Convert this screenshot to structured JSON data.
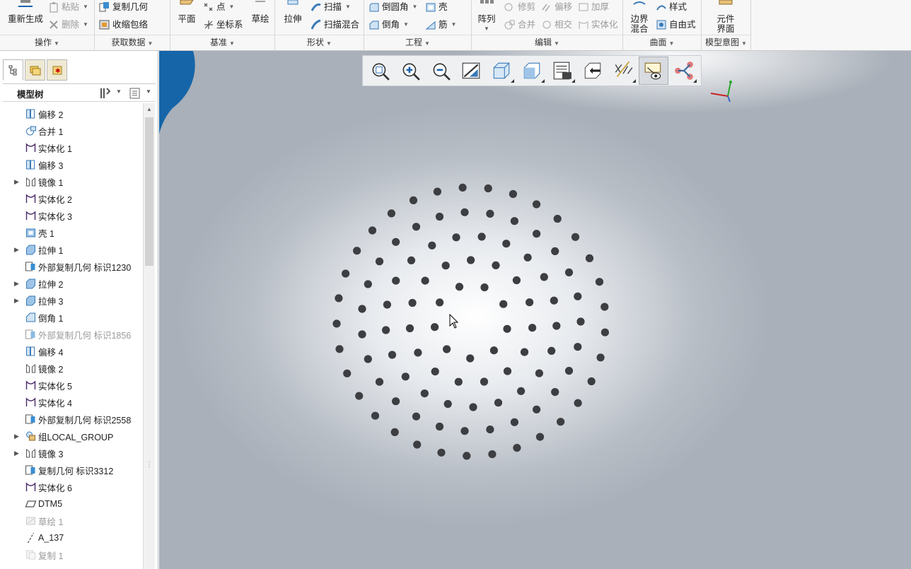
{
  "ribbon": {
    "groups": [
      {
        "label": "操作",
        "items": [
          {
            "label": "重新生成",
            "icon": "regenerate-icon",
            "disabled": false
          },
          {
            "label": "粘贴",
            "icon": "paste-icon",
            "disabled": true
          },
          {
            "label": "删除",
            "icon": "delete-icon",
            "disabled": true
          }
        ]
      },
      {
        "label": "获取数据",
        "items": [
          {
            "label": "复制几何",
            "icon": "copy-geometry-icon",
            "disabled": false
          },
          {
            "label": "收缩包络",
            "icon": "shrinkwrap-icon",
            "disabled": false
          }
        ]
      },
      {
        "label": "基准",
        "items": [
          {
            "label": "平面",
            "icon": "plane-icon",
            "disabled": false
          },
          {
            "label": "点",
            "icon": "point-icon",
            "disabled": false
          },
          {
            "label": "坐标系",
            "icon": "coordinate-system-icon",
            "disabled": false
          },
          {
            "label": "草绘",
            "icon": "sketch-icon",
            "disabled": false
          }
        ]
      },
      {
        "label": "形状",
        "items": [
          {
            "label": "拉伸",
            "icon": "extrude-icon",
            "disabled": false
          },
          {
            "label": "扫描",
            "icon": "sweep-icon",
            "disabled": false
          },
          {
            "label": "扫描混合",
            "icon": "swept-blend-icon",
            "disabled": false
          }
        ]
      },
      {
        "label": "工程",
        "items": [
          {
            "label": "倒圆角",
            "icon": "round-icon",
            "disabled": false
          },
          {
            "label": "倒角",
            "icon": "chamfer-icon",
            "disabled": false
          },
          {
            "label": "壳",
            "icon": "shell-icon",
            "disabled": false
          },
          {
            "label": "筋",
            "icon": "rib-icon",
            "disabled": false
          }
        ]
      },
      {
        "label": "编辑",
        "items": [
          {
            "label": "阵列",
            "icon": "pattern-icon",
            "disabled": false
          },
          {
            "label": "修剪",
            "icon": "trim-icon",
            "disabled": true
          },
          {
            "label": "合并",
            "icon": "merge-icon",
            "disabled": true
          },
          {
            "label": "偏移",
            "icon": "offset-icon",
            "disabled": true
          },
          {
            "label": "相交",
            "icon": "intersect-icon",
            "disabled": true
          },
          {
            "label": "加厚",
            "icon": "thicken-icon",
            "disabled": true
          },
          {
            "label": "实体化",
            "icon": "solidify-icon",
            "disabled": true
          }
        ]
      },
      {
        "label": "曲面",
        "items": [
          {
            "label": "边界混合",
            "icon": "boundary-blend-icon",
            "disabled": false
          },
          {
            "label": "样式",
            "icon": "style-icon",
            "disabled": false
          },
          {
            "label": "自由式",
            "icon": "freestyle-icon",
            "disabled": false
          }
        ]
      },
      {
        "label": "模型意图",
        "items": [
          {
            "label": "元件界面",
            "icon": "component-interface-icon",
            "disabled": false
          }
        ]
      }
    ]
  },
  "tree": {
    "title": "模型树",
    "nodes": [
      {
        "label": "偏移 2",
        "icon": "offset-icon",
        "expandable": false,
        "dim": false
      },
      {
        "label": "合并 1",
        "icon": "merge-icon",
        "expandable": false,
        "dim": false
      },
      {
        "label": "实体化 1",
        "icon": "solidify-icon",
        "expandable": false,
        "dim": false
      },
      {
        "label": "偏移 3",
        "icon": "offset-icon",
        "expandable": false,
        "dim": false
      },
      {
        "label": "镜像 1",
        "icon": "mirror-icon",
        "expandable": true,
        "dim": false
      },
      {
        "label": "实体化 2",
        "icon": "solidify-icon",
        "expandable": false,
        "dim": false
      },
      {
        "label": "实体化 3",
        "icon": "solidify-icon",
        "expandable": false,
        "dim": false
      },
      {
        "label": "壳 1",
        "icon": "shell-icon",
        "expandable": false,
        "dim": false
      },
      {
        "label": "拉伸 1",
        "icon": "extrude-icon",
        "expandable": true,
        "dim": false
      },
      {
        "label": "外部复制几何 标识1230",
        "icon": "copy-geometry-icon",
        "expandable": false,
        "dim": false
      },
      {
        "label": "拉伸 2",
        "icon": "extrude-icon",
        "expandable": true,
        "dim": false
      },
      {
        "label": "拉伸 3",
        "icon": "extrude-icon",
        "expandable": true,
        "dim": false
      },
      {
        "label": "倒角 1",
        "icon": "chamfer-icon",
        "expandable": false,
        "dim": false
      },
      {
        "label": "外部复制几何 标识1856",
        "icon": "copy-geometry-icon",
        "expandable": false,
        "dim": true
      },
      {
        "label": "偏移 4",
        "icon": "offset-icon",
        "expandable": false,
        "dim": false
      },
      {
        "label": "镜像 2",
        "icon": "mirror-icon",
        "expandable": false,
        "dim": false
      },
      {
        "label": "实体化 5",
        "icon": "solidify-icon",
        "expandable": false,
        "dim": false
      },
      {
        "label": "实体化 4",
        "icon": "solidify-icon",
        "expandable": false,
        "dim": false
      },
      {
        "label": "外部复制几何 标识2558",
        "icon": "copy-geometry-icon",
        "expandable": false,
        "dim": false
      },
      {
        "label": "组LOCAL_GROUP",
        "icon": "group-icon",
        "expandable": true,
        "dim": false
      },
      {
        "label": "镜像 3",
        "icon": "mirror-icon",
        "expandable": true,
        "dim": false
      },
      {
        "label": "复制几何 标识3312",
        "icon": "copy-geometry-icon",
        "expandable": false,
        "dim": false
      },
      {
        "label": "实体化 6",
        "icon": "solidify-icon",
        "expandable": false,
        "dim": false
      },
      {
        "label": "DTM5",
        "icon": "datum-plane-icon",
        "expandable": false,
        "dim": false
      },
      {
        "label": "草绘 1",
        "icon": "sketch-icon",
        "expandable": false,
        "dim": true
      },
      {
        "label": "A_137",
        "icon": "axis-icon",
        "expandable": false,
        "dim": false
      },
      {
        "label": "复制 1",
        "icon": "copy-icon",
        "expandable": false,
        "dim": true
      }
    ]
  },
  "view_toolbar": {
    "buttons": [
      "refit-icon",
      "zoom-in-icon",
      "zoom-out-icon",
      "repaint-icon",
      "display-style-icon",
      "saved-orientations-icon",
      "view-manager-icon",
      "perspective-view-icon",
      "section-icon",
      "datum-display-filters-icon",
      "annotation-display-icon",
      "spin-center-icon"
    ]
  },
  "colors": {
    "ribbon_bg": "#f7f7f7",
    "viewport_bg": "#b8bec6",
    "hole": "#3c3e42",
    "accent_blue": "#1565a8"
  }
}
